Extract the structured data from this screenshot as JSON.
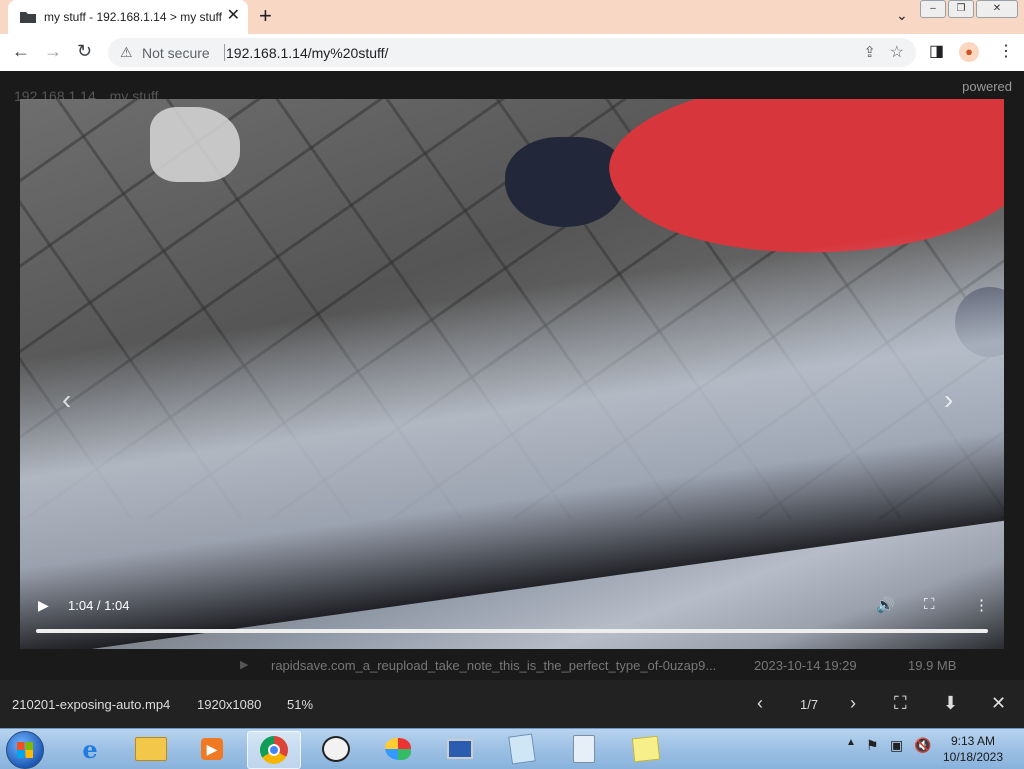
{
  "browser": {
    "tab_title": "my stuff - 192.168.1.14 > my stuff",
    "tab_close": "✕",
    "new_tab": "+",
    "tab_menu": "⌄",
    "security_label": "Not secure",
    "url": "192.168.1.14/my%20stuff/",
    "icons": {
      "back": "back-arrow-icon",
      "forward": "forward-arrow-icon",
      "reload": "reload-icon",
      "warning": "warning-icon",
      "share": "share-icon",
      "bookmark": "star-icon",
      "sidepanel": "side-panel-icon",
      "profile": "profile-icon",
      "menu": "kebab-menu-icon"
    }
  },
  "page": {
    "breadcrumb": [
      "192.168.1.14",
      "my stuff"
    ],
    "powered": "powered"
  },
  "video": {
    "time": "1:04 / 1:04",
    "progress": 1.0,
    "prev_glyph": "‹",
    "next_glyph": "›"
  },
  "listing": {
    "filename": "rapidsave.com_a_reupload_take_note_this_is_the_perfect_type_of-0uzap9...",
    "date": "2023-10-14 19:29",
    "size": "19.9 MB"
  },
  "viewer": {
    "filename": "210201-exposing-auto.mp4",
    "resolution": "1920x1080",
    "zoom": "51%",
    "counter": "1/7"
  },
  "taskbar": {
    "apps": [
      "internet-explorer",
      "file-explorer",
      "media-player",
      "chrome",
      "panda-app",
      "paint",
      "remote-desktop",
      "notepad",
      "calculator",
      "sticky-notes"
    ],
    "clock_time": "9:13 AM",
    "clock_date": "10/18/2023"
  }
}
